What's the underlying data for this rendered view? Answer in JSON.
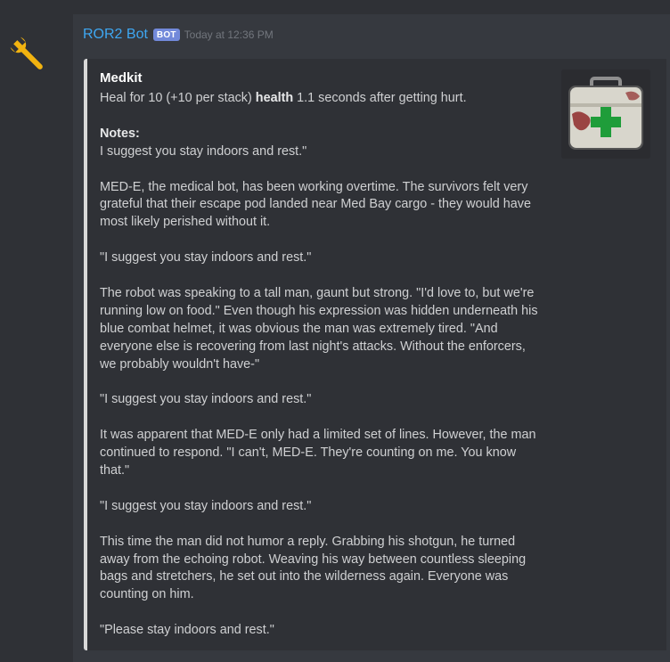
{
  "message": {
    "username": "ROR2 Bot",
    "bot_tag": "BOT",
    "timestamp": "Today at 12:36 PM"
  },
  "embed": {
    "title": "Medkit",
    "desc_pre": "Heal for 10 (+10 per stack) ",
    "desc_bold": "health",
    "desc_post": " 1.1 seconds after getting hurt.",
    "notes_title": "Notes:",
    "notes_text": "I suggest you stay indoors and rest.\"\n\nMED-E, the medical bot, has been working overtime. The survivors felt very grateful that their escape pod landed near Med Bay cargo - they would have most likely perished without it.\n\n\"I suggest you stay indoors and rest.\"\n\nThe robot was speaking to a tall man, gaunt but strong. \"I'd love to, but we're running low on food.\" Even though his expression was hidden underneath his blue combat helmet, it was obvious the man was extremely tired. \"And everyone else is recovering from last night's attacks. Without the enforcers, we probably wouldn't have-\"\n\n\"I suggest you stay indoors and rest.\"\n\nIt was apparent that MED-E only had a limited set of lines. However, the man continued to respond. \"I can't, MED-E. They're counting on me. You know that.\"\n\n\"I suggest you stay indoors and rest.\"\n\nThis time the man did not humor a reply. Grabbing his shotgun, he turned away from the echoing robot. Weaving his way between countless sleeping bags and stretchers, he set out into the wilderness again. Everyone was counting on him.\n\n\"Please stay indoors and rest.\""
  },
  "icons": {
    "avatar": "wrench-icon",
    "thumbnail": "medkit-icon"
  },
  "colors": {
    "username": "#3ea7f2",
    "bot_tag": "#7289da",
    "embed_border": "#d8d8d8",
    "medkit_cross": "#1f9d3a"
  }
}
